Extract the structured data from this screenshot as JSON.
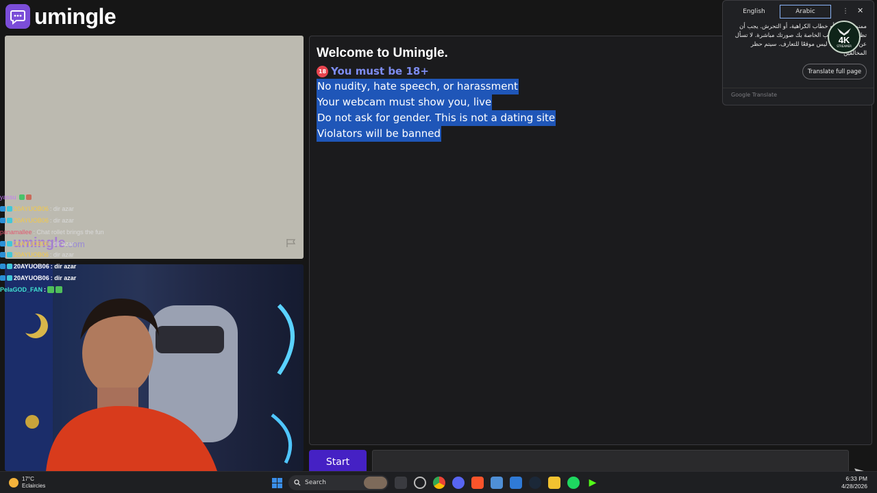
{
  "header": {
    "app_name": "umingle"
  },
  "video": {
    "watermark_main": "umingle",
    "watermark_suffix": ".com"
  },
  "chat": [
    {
      "user": "yassu",
      "msg": "",
      "style": "purple"
    },
    {
      "user": "20AYUOB06",
      "msg": ": dir azar",
      "style": "yellow"
    },
    {
      "user": "20AYUOB06",
      "msg": ": dir azar",
      "style": "yellow"
    },
    {
      "user": "panamallee",
      "msg": ": Chat rollet brings the fun",
      "style": "pink"
    },
    {
      "user": "20AYUOB06",
      "msg": ": dir azar",
      "style": "yellow"
    },
    {
      "user": "20AYUOB06",
      "msg": ": dir azar",
      "style": "yellow"
    },
    {
      "user": "20AYUOB06",
      "msg": ": dir azar",
      "style": "bold"
    },
    {
      "user": "20AYUOB06",
      "msg": ": dir azar",
      "style": "bold"
    },
    {
      "user": "PelaGOD_FAN",
      "msg": ":",
      "style": "cyan"
    }
  ],
  "welcome": {
    "title": "Welcome to Umingle.",
    "age_rule": "You must be 18+",
    "age_icon": "18",
    "rules": [
      "No nudity, hate speech, or harassment",
      "Your webcam must show you, live",
      "Do not ask for gender. This is not a dating site",
      "Violators will be banned"
    ]
  },
  "controls": {
    "start_label": "Start"
  },
  "translate": {
    "tab_source": "English",
    "tab_target": "Arabic",
    "more_icon": "⋮",
    "close_icon": "✕",
    "translated_text": "ممنوع العري أو خطاب الكراهية، أو التحرش. يجب أن تظهر كاميرا الويب الخاصة بك صورتك مباشرة. لا تسأل عن الجنس. هذا ليس موقعًا للتعارف. سيتم حظر المخالفين",
    "full_page_label": "Translate full page",
    "brand": "Google Translate"
  },
  "stream_logo": {
    "big": "4K",
    "small": "STREAMER"
  },
  "taskbar": {
    "temperature": "17°C",
    "condition": "Eclaircies",
    "search_label": "Search",
    "time": "6:33 PM",
    "date": "4/28/2026"
  },
  "colors": {
    "accent": "#4521c4",
    "highlight": "#1f56b8",
    "age_rule": "#7d8cf0"
  }
}
